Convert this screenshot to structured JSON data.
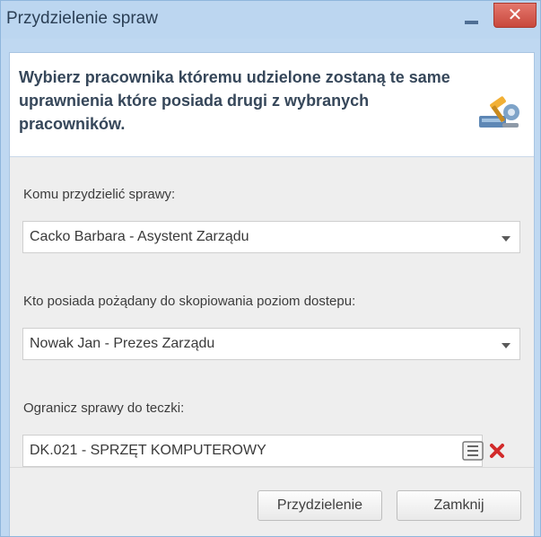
{
  "window": {
    "title": "Przydzielenie spraw"
  },
  "header": {
    "text": "Wybierz pracownika któremu udzielone zostaną te same uprawnienia które posiada drugi z wybranych pracowników.",
    "icon": "tools-icon"
  },
  "form": {
    "assignee_label": "Komu przydzielić sprawy:",
    "assignee_value": "Cacko Barbara - Asystent Zarządu",
    "source_label": "Kto posiada pożądany do skopiowania poziom dostepu:",
    "source_value": "Nowak Jan - Prezes Zarządu",
    "folder_label": "Ogranicz sprawy do teczki:",
    "folder_value": "DK.021 - SPRZĘT KOMPUTEROWY"
  },
  "buttons": {
    "assign": "Przydzielenie",
    "close": "Zamknij"
  },
  "colors": {
    "title_bar": "#bcd6f0",
    "close_button": "#d0564a",
    "delete_icon": "#d22a2a"
  }
}
